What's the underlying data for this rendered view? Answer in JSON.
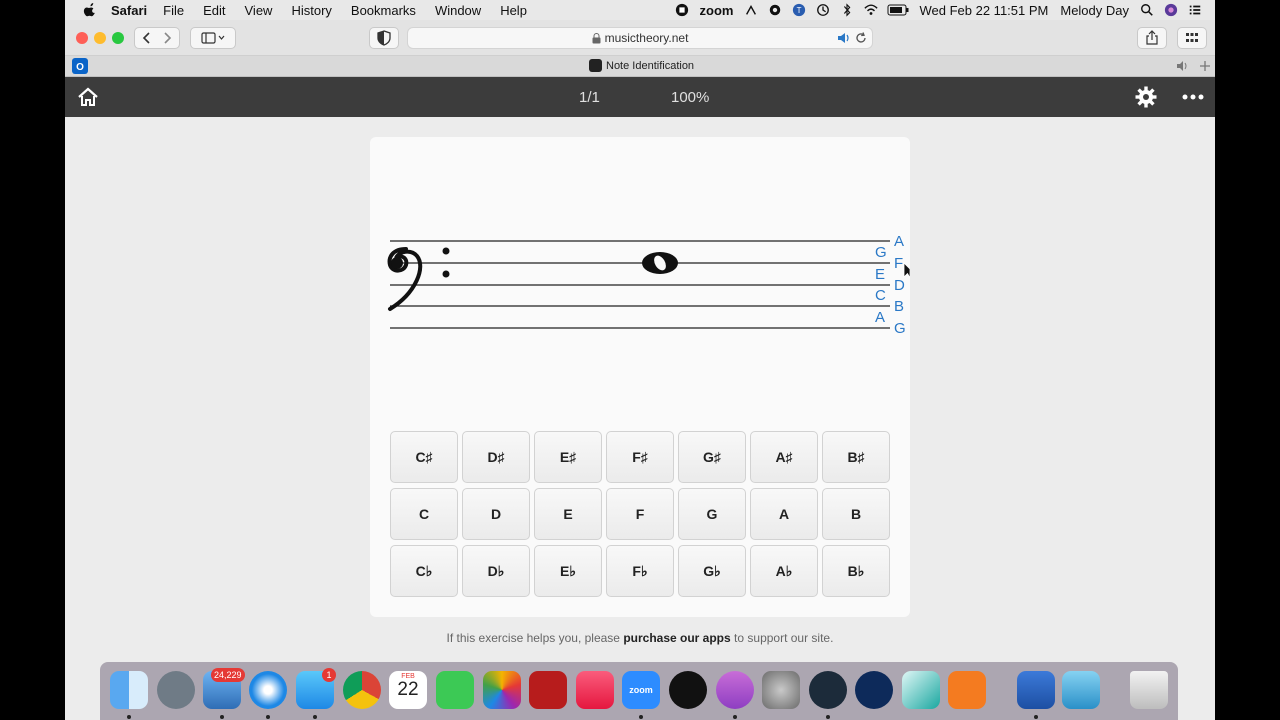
{
  "menubar": {
    "app_name": "Safari",
    "menus": [
      "File",
      "Edit",
      "View",
      "History",
      "Bookmarks",
      "Window",
      "Help"
    ],
    "zoom_label": "zoom",
    "datetime": "Wed Feb 22  11:51 PM",
    "user": "Melody Day"
  },
  "browser": {
    "url": "musictheory.net",
    "tab_title": "Note Identification"
  },
  "site_header": {
    "page_counter": "1/1",
    "zoom_level": "100%"
  },
  "staff": {
    "clef": "bass-clef",
    "line_labels": [
      "A",
      "F",
      "D",
      "B",
      "G"
    ],
    "space_labels": [
      "G",
      "E",
      "C",
      "A"
    ],
    "note_type": "whole-note"
  },
  "answer_buttons": {
    "sharps": [
      "C♯",
      "D♯",
      "E♯",
      "F♯",
      "G♯",
      "A♯",
      "B♯"
    ],
    "naturals": [
      "C",
      "D",
      "E",
      "F",
      "G",
      "A",
      "B"
    ],
    "flats": [
      "C♭",
      "D♭",
      "E♭",
      "F♭",
      "G♭",
      "A♭",
      "B♭"
    ]
  },
  "footer": {
    "prefix": "If this exercise helps you, please",
    "link": "purchase our apps",
    "suffix": "to support our site."
  },
  "dock": {
    "mail_badge": "24,229",
    "messages_badge": "1",
    "calendar_month": "FEB",
    "calendar_day": "22",
    "zoom_label": "zoom"
  },
  "colors": {
    "label_blue": "#2a78c6",
    "header_bg": "#3c3c3c",
    "page_bg": "#ececec",
    "card_bg": "#fafafa"
  }
}
